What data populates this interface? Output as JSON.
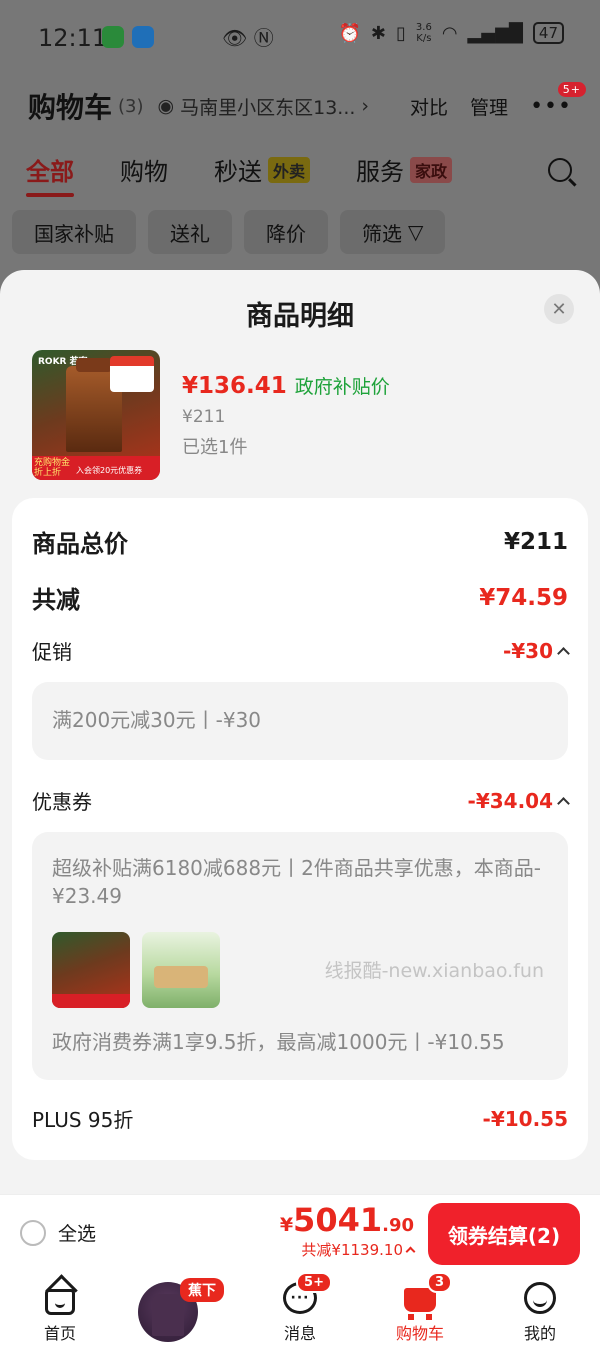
{
  "status": {
    "time": "12:11",
    "net_speed_value": "3.6",
    "net_speed_unit": "K/s",
    "battery": "47"
  },
  "header": {
    "title": "购物车",
    "count": "(3)",
    "address": "马南里小区东区13...",
    "compare": "对比",
    "manage": "管理",
    "more_badge": "5+"
  },
  "tabs": [
    {
      "label": "全部"
    },
    {
      "label": "购物"
    },
    {
      "label": "秒送",
      "tag": "外卖"
    },
    {
      "label": "服务",
      "tag": "家政"
    }
  ],
  "filters": [
    "国家补贴",
    "送礼",
    "降价",
    "筛选"
  ],
  "sheet": {
    "title": "商品明细",
    "product": {
      "price": "¥136.41",
      "price_label": "政府补贴价",
      "original_price": "¥211",
      "selected": "已选1件",
      "thumb_brand": "ROKR 若客",
      "thumb_promo": "充购物金 折上折",
      "thumb_coupon": "入会领20元优惠券"
    },
    "total_label": "商品总价",
    "total_value": "¥211",
    "reduce_label": "共减",
    "reduce_value": "¥74.59",
    "promo_label": "促销",
    "promo_value": "-¥30",
    "promo_detail": "满200元减30元丨-¥30",
    "coupon_label": "优惠券",
    "coupon_value": "-¥34.04",
    "coupon_detail_1": "超级补贴满6180减688元丨2件商品共享优惠，本商品-¥23.49",
    "watermark": "线报酷-new.xianbao.fun",
    "coupon_detail_2": "政府消费券满1享9.5折，最高减1000元丨-¥10.55",
    "plus_label": "PLUS 95折",
    "plus_value": "-¥10.55"
  },
  "bottom": {
    "select_all": "全选",
    "currency": "¥",
    "total_int": "5041",
    "total_dec": ".90",
    "discount": "共减¥1139.10",
    "checkout": "领券结算(2)"
  },
  "nav": {
    "home": "首页",
    "promo_tag": "蕉下",
    "messages": "消息",
    "messages_badge": "5+",
    "cart": "购物车",
    "cart_badge": "3",
    "me": "我的"
  },
  "colors": {
    "accent_red": "#e8281e",
    "subsidy_green": "#1ea23a",
    "checkout_red": "#f0212b"
  }
}
